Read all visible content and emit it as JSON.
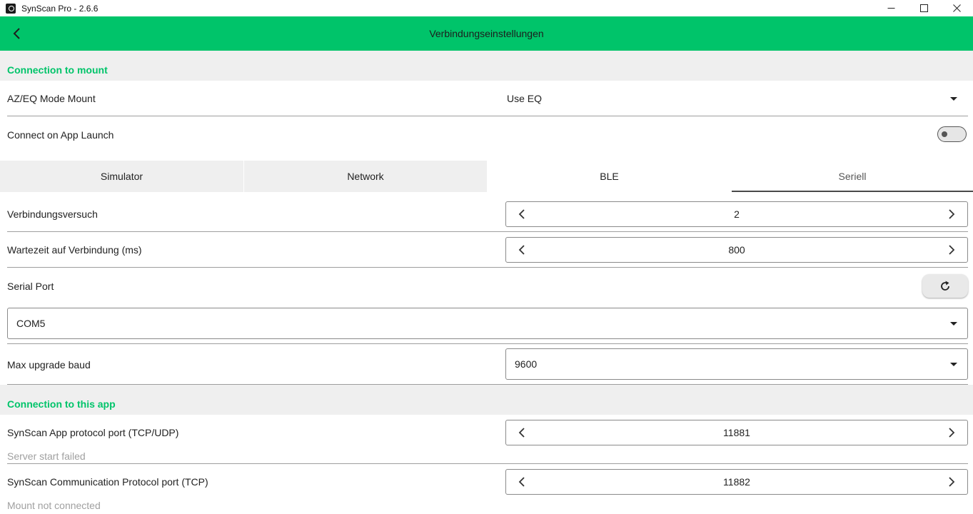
{
  "window": {
    "title": "SynScan Pro - 2.6.6",
    "minimize": "—",
    "maximize": "☐",
    "close": "✕"
  },
  "header": {
    "title": "Verbindungseinstellungen"
  },
  "mount_section": {
    "title": "Connection to mount",
    "mode": {
      "label": "AZ/EQ Mode Mount",
      "value": "Use EQ"
    },
    "connect_on_launch": {
      "label": "Connect on App Launch",
      "enabled": false
    }
  },
  "tabs": [
    {
      "label": "Simulator"
    },
    {
      "label": "Network"
    },
    {
      "label": "BLE"
    },
    {
      "label": "Seriell",
      "active": true
    }
  ],
  "serial": {
    "attempts": {
      "label": "Verbindungsversuch",
      "value": "2"
    },
    "wait_time": {
      "label": "Wartezeit auf Verbindung (ms)",
      "value": "800"
    },
    "port": {
      "label": "Serial Port",
      "value": "COM5"
    },
    "baud": {
      "label": "Max upgrade baud",
      "value": "9600"
    }
  },
  "app_section": {
    "title": "Connection to this app",
    "app_port": {
      "label": "SynScan App protocol port (TCP/UDP)",
      "value": "11881",
      "status": "Server start failed"
    },
    "comm_port": {
      "label": "SynScan Communication Protocol port (TCP)",
      "value": "11882",
      "status": "Mount not connected"
    }
  },
  "colors": {
    "accent": "#00c46a",
    "section_bg": "#efefef",
    "status_text": "#a0a0a0"
  }
}
